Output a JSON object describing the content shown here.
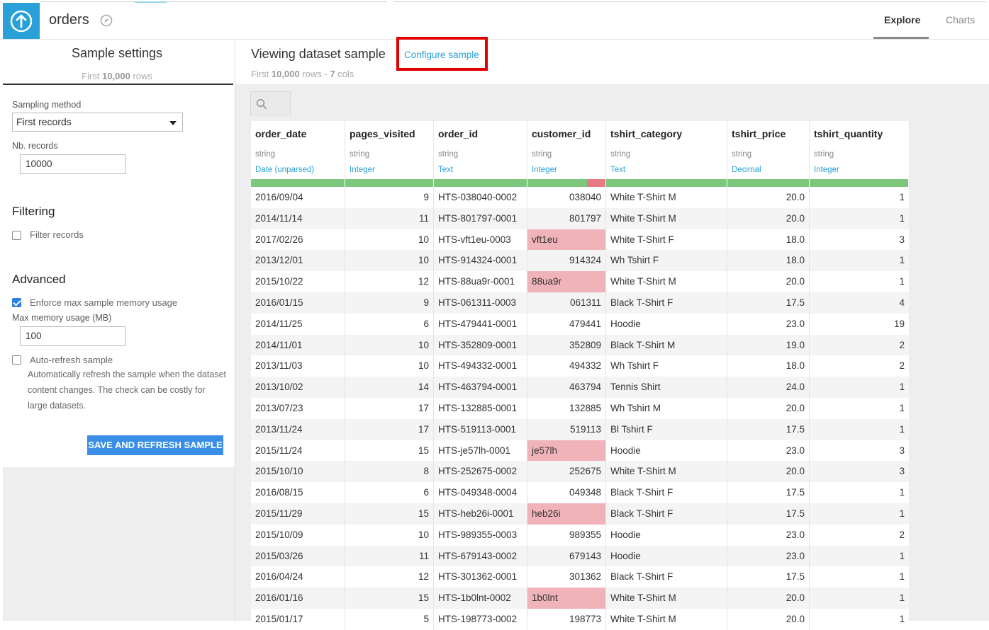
{
  "header": {
    "dataset_name": "orders",
    "tabs": [
      {
        "label": "Explore",
        "active": true
      },
      {
        "label": "Charts",
        "active": false
      }
    ]
  },
  "sample_settings": {
    "title": "Sample settings",
    "subtitle_prefix": "First",
    "subtitle_count": "10,000",
    "subtitle_suffix": "rows",
    "sampling_method_label": "Sampling method",
    "sampling_method_value": "First records",
    "nb_records_label": "Nb. records",
    "nb_records_value": "10000",
    "filtering_heading": "Filtering",
    "filter_records_label": "Filter records",
    "filter_records_checked": false,
    "advanced_heading": "Advanced",
    "enforce_label": "Enforce max sample memory usage",
    "enforce_checked": true,
    "max_memory_label": "Max memory usage (MB)",
    "max_memory_value": "100",
    "auto_refresh_label": "Auto-refresh sample",
    "auto_refresh_checked": false,
    "auto_refresh_help": "Automatically refresh the sample when the dataset content changes. The check can be costly for large datasets.",
    "save_button": "SAVE AND REFRESH SAMPLE"
  },
  "viewer": {
    "title": "Viewing dataset sample",
    "configure_link": "Configure sample",
    "subtitle_prefix": "First",
    "subtitle_rows": "10,000",
    "subtitle_rows_label": "rows -",
    "subtitle_cols": "7",
    "subtitle_cols_label": "cols"
  },
  "colors": {
    "accent": "#29a0d8",
    "valid": "#7ec87e",
    "invalid": "#e77b84",
    "invalid_cell": "#f0b3b9",
    "highlight_box": "#e00000",
    "button": "#3a8ee6"
  },
  "table": {
    "columns": [
      {
        "name": "order_date",
        "type": "string",
        "meaning": "Date (unparsed)",
        "align": "left"
      },
      {
        "name": "pages_visited",
        "type": "string",
        "meaning": "Integer",
        "align": "right"
      },
      {
        "name": "order_id",
        "type": "string",
        "meaning": "Text",
        "align": "left"
      },
      {
        "name": "customer_id",
        "type": "string",
        "meaning": "Integer",
        "align": "right",
        "has_invalid": true
      },
      {
        "name": "tshirt_category",
        "type": "string",
        "meaning": "Text",
        "align": "left"
      },
      {
        "name": "tshirt_price",
        "type": "string",
        "meaning": "Decimal",
        "align": "right"
      },
      {
        "name": "tshirt_quantity",
        "type": "string",
        "meaning": "Integer",
        "align": "right"
      }
    ],
    "rows": [
      [
        "2016/09/04",
        "9",
        "HTS-038040-0002",
        "038040",
        "White T-Shirt M",
        "20.0",
        "1"
      ],
      [
        "2014/11/14",
        "11",
        "HTS-801797-0001",
        "801797",
        "White T-Shirt M",
        "20.0",
        "1"
      ],
      [
        "2017/02/26",
        "10",
        "HTS-vft1eu-0003",
        "vft1eu",
        "White T-Shirt F",
        "18.0",
        "3"
      ],
      [
        "2013/12/01",
        "10",
        "HTS-914324-0001",
        "914324",
        "Wh Tshirt F",
        "18.0",
        "1"
      ],
      [
        "2015/10/22",
        "12",
        "HTS-88ua9r-0001",
        "88ua9r",
        "White T-Shirt M",
        "20.0",
        "1"
      ],
      [
        "2016/01/15",
        "9",
        "HTS-061311-0003",
        "061311",
        "Black T-Shirt F",
        "17.5",
        "4"
      ],
      [
        "2014/11/25",
        "6",
        "HTS-479441-0001",
        "479441",
        "Hoodie",
        "23.0",
        "19"
      ],
      [
        "2014/11/01",
        "10",
        "HTS-352809-0001",
        "352809",
        "Black T-Shirt M",
        "19.0",
        "2"
      ],
      [
        "2013/11/03",
        "10",
        "HTS-494332-0001",
        "494332",
        "Wh Tshirt F",
        "18.0",
        "2"
      ],
      [
        "2013/10/02",
        "14",
        "HTS-463794-0001",
        "463794",
        "Tennis Shirt",
        "24.0",
        "1"
      ],
      [
        "2013/07/23",
        "17",
        "HTS-132885-0001",
        "132885",
        "Wh Tshirt M",
        "20.0",
        "1"
      ],
      [
        "2013/11/24",
        "17",
        "HTS-519113-0001",
        "519113",
        "Bl Tshirt F",
        "17.5",
        "1"
      ],
      [
        "2015/11/24",
        "15",
        "HTS-je57lh-0001",
        "je57lh",
        "Hoodie",
        "23.0",
        "3"
      ],
      [
        "2015/10/10",
        "8",
        "HTS-252675-0002",
        "252675",
        "White T-Shirt M",
        "20.0",
        "3"
      ],
      [
        "2016/08/15",
        "6",
        "HTS-049348-0004",
        "049348",
        "Black T-Shirt F",
        "17.5",
        "1"
      ],
      [
        "2015/11/29",
        "15",
        "HTS-heb26i-0001",
        "heb26i",
        "Black T-Shirt F",
        "17.5",
        "1"
      ],
      [
        "2015/10/09",
        "10",
        "HTS-989355-0003",
        "989355",
        "Hoodie",
        "23.0",
        "2"
      ],
      [
        "2015/03/26",
        "11",
        "HTS-679143-0002",
        "679143",
        "Hoodie",
        "23.0",
        "1"
      ],
      [
        "2016/04/24",
        "12",
        "HTS-301362-0001",
        "301362",
        "Black T-Shirt F",
        "17.5",
        "1"
      ],
      [
        "2016/01/16",
        "15",
        "HTS-1b0lnt-0002",
        "1b0lnt",
        "White T-Shirt M",
        "20.0",
        "1"
      ],
      [
        "2015/01/17",
        "5",
        "HTS-198773-0002",
        "198773",
        "White T-Shirt M",
        "20.0",
        "1"
      ]
    ],
    "invalid_cells": [
      [
        2,
        3
      ],
      [
        4,
        3
      ],
      [
        12,
        3
      ],
      [
        15,
        3
      ],
      [
        19,
        3
      ]
    ]
  }
}
